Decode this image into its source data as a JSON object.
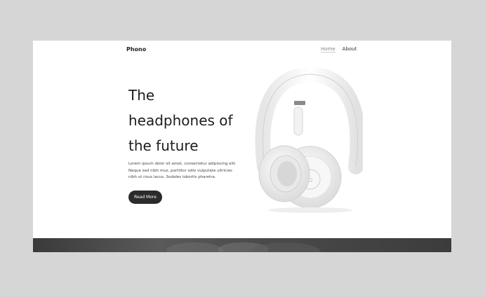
{
  "brand": "Phono",
  "nav": {
    "home": "Home",
    "about": "About"
  },
  "hero": {
    "title_lines": [
      "The",
      "headphones of",
      "the future"
    ],
    "description": "Lorem ipsum dolor sit amet, consectetur adipiscing elit. Neque sed nibh mus, porttitor odio vulputate ultricies nibh ut risus lacus. Sodales lobortis pharetra.",
    "button": "Read More"
  }
}
